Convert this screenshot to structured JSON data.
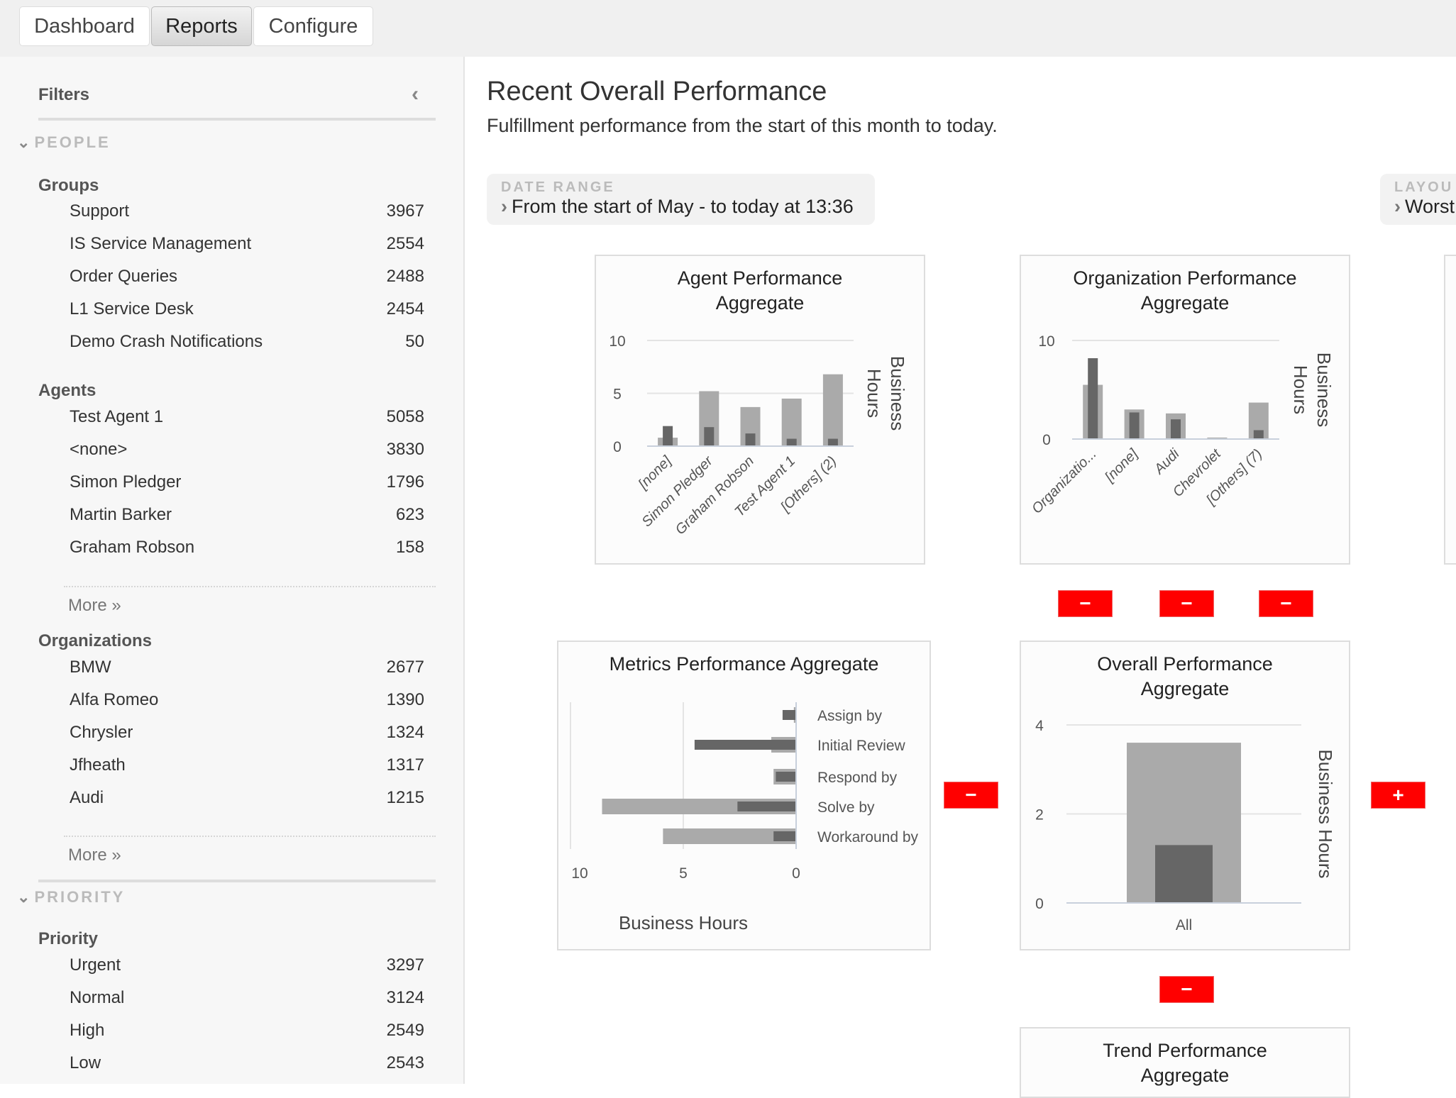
{
  "tabs": [
    {
      "label": "Dashboard",
      "active": false
    },
    {
      "label": "Reports",
      "active": true
    },
    {
      "label": "Configure",
      "active": false
    }
  ],
  "sidebar": {
    "title": "Filters",
    "collapse_icon": "chevron-left-icon",
    "people_section": "PEOPLE",
    "groups_label": "Groups",
    "groups": [
      {
        "label": "Support",
        "count": "3967"
      },
      {
        "label": "IS Service Management",
        "count": "2554"
      },
      {
        "label": "Order Queries",
        "count": "2488"
      },
      {
        "label": "L1 Service Desk",
        "count": "2454"
      },
      {
        "label": "Demo Crash Notifications",
        "count": "50"
      }
    ],
    "agents_label": "Agents",
    "agents": [
      {
        "label": "Test Agent 1",
        "count": "5058"
      },
      {
        "label": "<none>",
        "count": "3830"
      },
      {
        "label": "Simon Pledger",
        "count": "1796"
      },
      {
        "label": "Martin Barker",
        "count": "623"
      },
      {
        "label": "Graham Robson",
        "count": "158"
      }
    ],
    "more_label": "More »",
    "organizations_label": "Organizations",
    "organizations": [
      {
        "label": "BMW",
        "count": "2677"
      },
      {
        "label": "Alfa Romeo",
        "count": "1390"
      },
      {
        "label": "Chrysler",
        "count": "1324"
      },
      {
        "label": "Jfheath",
        "count": "1317"
      },
      {
        "label": "Audi",
        "count": "1215"
      }
    ],
    "priority_section": "PRIORITY",
    "priority_label": "Priority",
    "priorities": [
      {
        "label": "Urgent",
        "count": "3297"
      },
      {
        "label": "Normal",
        "count": "3124"
      },
      {
        "label": "High",
        "count": "2549"
      },
      {
        "label": "Low",
        "count": "2543"
      }
    ]
  },
  "main": {
    "title": "Recent Overall Performance",
    "subtitle": "Fulfillment performance from the start of this month to today.",
    "date_range": {
      "label": "DATE RANGE",
      "value": "From the start of May - to today at 13:36"
    },
    "layout": {
      "label": "LAYOU",
      "value": "Worst"
    },
    "buttons": {
      "minus": "−",
      "plus": "+"
    }
  },
  "colors": {
    "light_bar": "#aaaaaa",
    "dark_bar": "#666666",
    "button_red": "#ff0000",
    "grid": "#e4e4e4",
    "axis": "#c8d0dc"
  },
  "chart_data": [
    {
      "type": "bar",
      "title": "Agent Performance Aggregate",
      "ylabel": "Business Hours",
      "ylim": [
        0,
        10
      ],
      "yticks": [
        0,
        5,
        10
      ],
      "categories": [
        "[none]",
        "Simon Pledger",
        "Graham Robson",
        "Test Agent 1",
        "[Others] (2)"
      ],
      "series": [
        {
          "values": [
            0.8,
            5.2,
            3.7,
            4.5,
            6.8
          ]
        },
        {
          "values": [
            1.9,
            1.8,
            1.2,
            0.7,
            0.7
          ]
        }
      ]
    },
    {
      "type": "bar",
      "title": "Organization Performance Aggregate",
      "ylabel": "Business Hours",
      "ylim": [
        0,
        10
      ],
      "yticks": [
        0,
        10
      ],
      "categories": [
        "Organizatio...",
        "[none]",
        "Audi",
        "Chevrolet",
        "[Others] (7)"
      ],
      "series": [
        {
          "values": [
            5.5,
            3.0,
            2.6,
            0.15,
            3.7
          ]
        },
        {
          "values": [
            8.2,
            2.7,
            2.0,
            0,
            0.9
          ]
        }
      ]
    },
    {
      "type": "bar",
      "orientation": "horizontal",
      "title": "Metrics Performance Aggregate",
      "xlabel": "Business Hours",
      "xlim": [
        0,
        10
      ],
      "xticks": [
        10,
        5,
        0
      ],
      "categories": [
        "Assign by",
        "Initial Review",
        "Respond by",
        "Solve by",
        "Workaround by"
      ],
      "series": [
        {
          "values": [
            0.1,
            1.1,
            1.0,
            8.6,
            5.9
          ]
        },
        {
          "values": [
            0.6,
            4.5,
            0.9,
            2.6,
            1.0
          ]
        }
      ]
    },
    {
      "type": "bar",
      "title": "Overall Performance Aggregate",
      "ylabel": "Business Hours",
      "ylim": [
        0,
        4
      ],
      "yticks": [
        0,
        2,
        4
      ],
      "categories": [
        "All"
      ],
      "series": [
        {
          "values": [
            3.6
          ]
        },
        {
          "values": [
            1.3
          ]
        }
      ]
    },
    {
      "type": "bar",
      "title": "Trend Performance Aggregate"
    }
  ]
}
